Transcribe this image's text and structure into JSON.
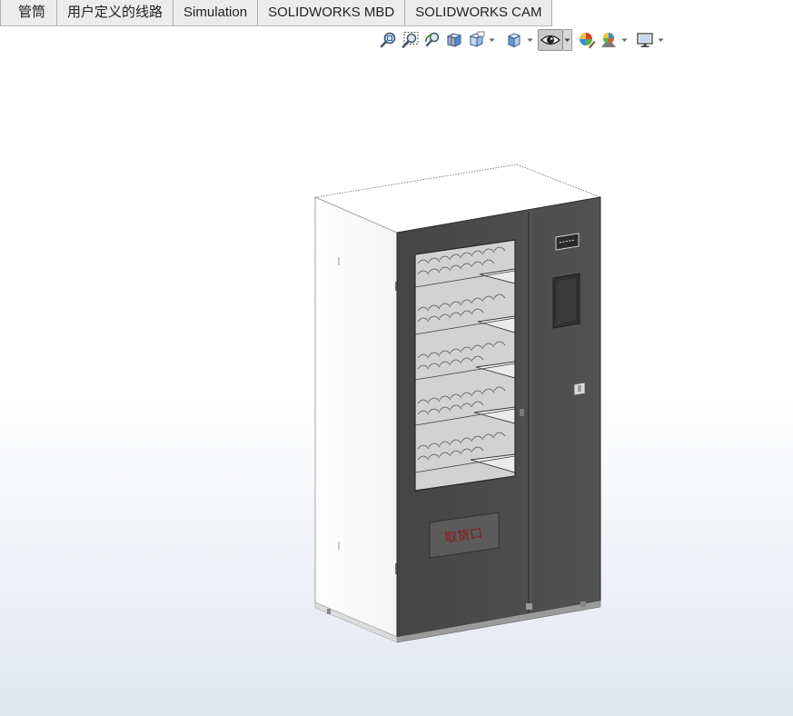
{
  "tabs": [
    {
      "label": "管筒"
    },
    {
      "label": "用户定义的线路"
    },
    {
      "label": "Simulation"
    },
    {
      "label": "SOLIDWORKS MBD"
    },
    {
      "label": "SOLIDWORKS CAM"
    }
  ],
  "heads_up_toolbar": {
    "tools": [
      {
        "icon": "zoom-to-fit-icon"
      },
      {
        "icon": "zoom-to-area-icon"
      },
      {
        "icon": "previous-view-icon"
      },
      {
        "icon": "section-view-icon"
      },
      {
        "icon": "dynamic-annotation-views-icon",
        "has_dropdown": true
      },
      {
        "icon": "view-orientation-icon",
        "has_dropdown": true
      },
      {
        "icon": "display-style-icon",
        "has_dropdown": true,
        "active": true
      },
      {
        "icon": "edit-appearance-icon"
      },
      {
        "icon": "apply-scene-icon",
        "has_dropdown": true
      },
      {
        "icon": "view-settings-icon",
        "has_dropdown": true
      }
    ]
  },
  "model": {
    "pickup_port_label": "取货口",
    "colors": {
      "cabinet_body": "#ffffff",
      "door_panel": "#4a4a4a",
      "window_glass": "#cfcfcf",
      "pickup_text": "#8b1a1a"
    }
  }
}
